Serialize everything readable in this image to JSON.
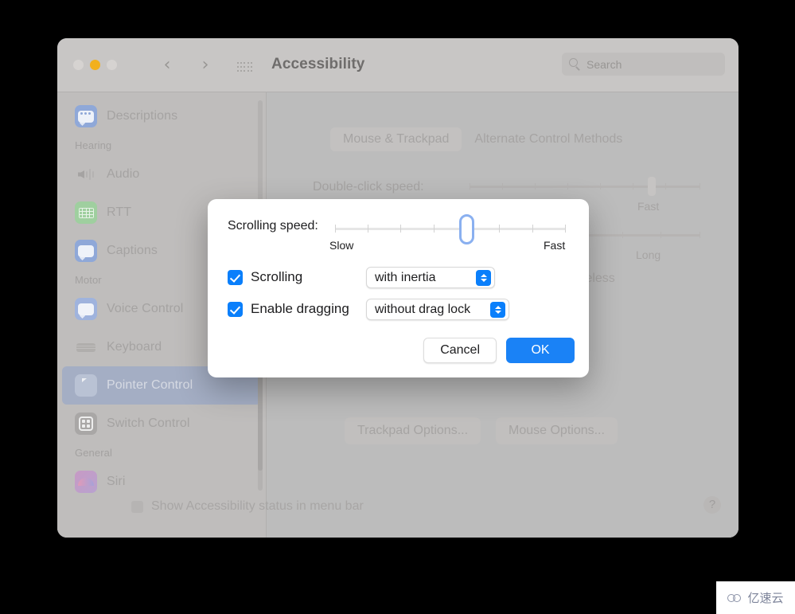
{
  "window": {
    "title": "Accessibility",
    "traffic_lights": [
      "close-grey",
      "minimize-yellow",
      "zoom-grey"
    ],
    "nav": {
      "back": "‹",
      "forward": "›"
    },
    "grid_icon": "apps-grid-icon",
    "search": {
      "placeholder": "Search",
      "value": "",
      "icon": "search-icon"
    }
  },
  "sidebar": {
    "items": [
      {
        "type": "item",
        "label": "Descriptions",
        "icon": "descriptions-icon",
        "selected": false
      },
      {
        "type": "group",
        "label": "Hearing"
      },
      {
        "type": "item",
        "label": "Audio",
        "icon": "audio-icon",
        "selected": false
      },
      {
        "type": "item",
        "label": "RTT",
        "icon": "rtt-icon",
        "selected": false
      },
      {
        "type": "item",
        "label": "Captions",
        "icon": "captions-icon",
        "selected": false
      },
      {
        "type": "group",
        "label": "Motor"
      },
      {
        "type": "item",
        "label": "Voice Control",
        "icon": "voice-control-icon",
        "selected": false
      },
      {
        "type": "item",
        "label": "Keyboard",
        "icon": "keyboard-icon",
        "selected": false
      },
      {
        "type": "item",
        "label": "Pointer Control",
        "icon": "pointer-icon",
        "selected": true
      },
      {
        "type": "item",
        "label": "Switch Control",
        "icon": "switch-control-icon",
        "selected": false
      },
      {
        "type": "group",
        "label": "General"
      },
      {
        "type": "item",
        "label": "Siri",
        "icon": "siri-icon",
        "selected": false
      }
    ]
  },
  "main": {
    "tabs": [
      {
        "label": "Mouse & Trackpad",
        "active": true
      },
      {
        "label": "Alternate Control Methods",
        "active": false
      }
    ],
    "double_click_label": "Double-click speed:",
    "double_click_fast": "Fast",
    "dwell_long": "Long",
    "wireless_label": "wireless",
    "trackpad_options_button": "Trackpad Options...",
    "mouse_options_button": "Mouse Options...",
    "footer_checkbox_label": "Show Accessibility status in menu bar",
    "footer_checkbox_checked": false,
    "help_button": "?"
  },
  "dialog": {
    "scrolling_speed_label": "Scrolling speed:",
    "slider": {
      "min_label": "Slow",
      "max_label": "Fast",
      "ticks": 8,
      "value_percent": 57
    },
    "scrolling": {
      "checkbox_label": "Scrolling",
      "checked": true,
      "popup_value": "with inertia"
    },
    "dragging": {
      "checkbox_label": "Enable dragging",
      "checked": true,
      "popup_value": "without drag lock"
    },
    "cancel_button": "Cancel",
    "ok_button": "OK"
  },
  "watermark": {
    "text": "亿速云",
    "icon": "cloud-logo-icon"
  },
  "colors": {
    "accent_blue": "#0a7ffb",
    "ok_button_blue": "#1a82f6",
    "selected_row": "#a4aec4",
    "window_chrome": "#c8c6c5",
    "window_body": "#bcbcbc",
    "minimize_yellow": "#f2b01e"
  }
}
